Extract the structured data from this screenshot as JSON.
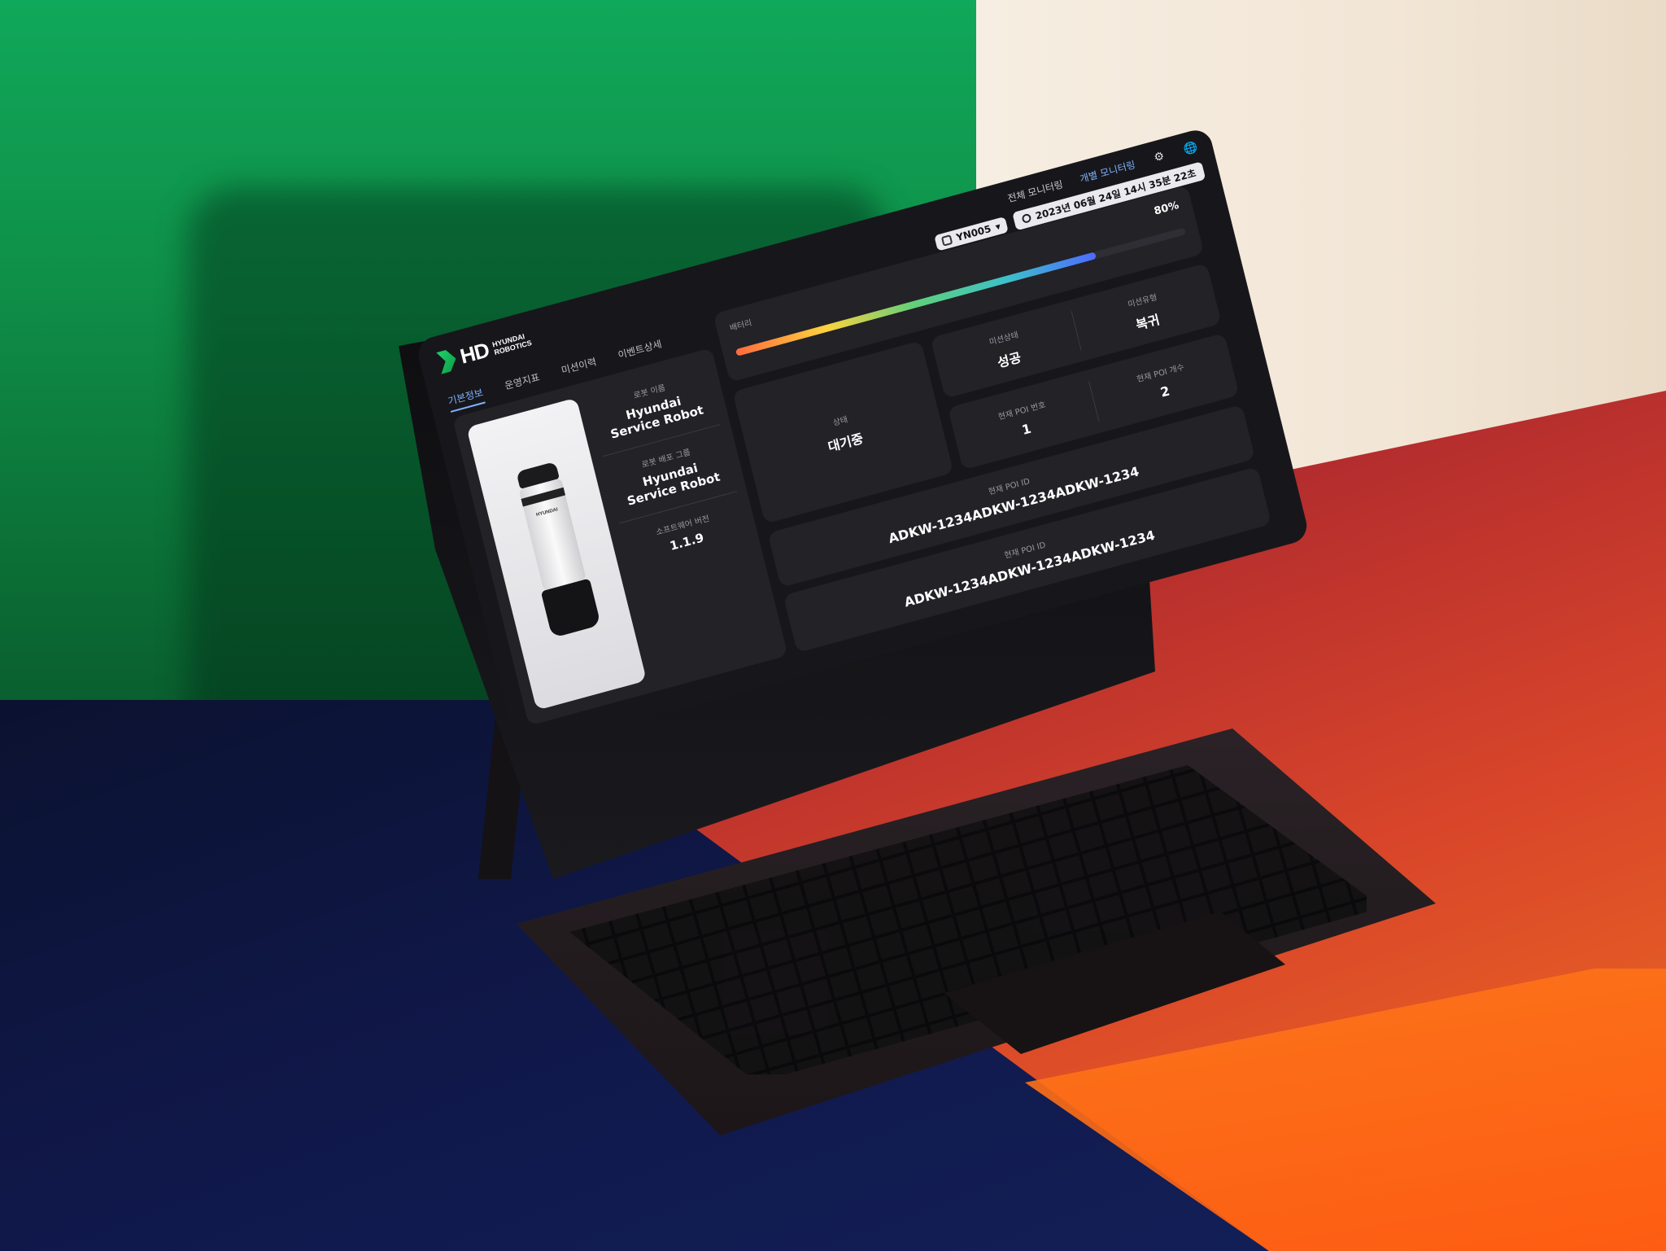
{
  "brand": {
    "logo_main": "HD",
    "logo_line1": "HYUNDAI",
    "logo_line2": "ROBOTICS"
  },
  "top_nav": {
    "overall": "전체 모니터링",
    "individual": "개별 모니터링"
  },
  "icons": {
    "settings": "gear-icon",
    "language": "globe-icon",
    "robot": "robot-icon",
    "clock": "clock-icon",
    "chevron": "chevron-down-icon"
  },
  "robot_select": {
    "value": "YN005"
  },
  "datetime": {
    "value": "2023년 06월 24일 14시 35분 22초"
  },
  "tabs": [
    {
      "label": "기본정보",
      "active": true
    },
    {
      "label": "운영지표",
      "active": false
    },
    {
      "label": "미션이력",
      "active": false
    },
    {
      "label": "이벤트상세",
      "active": false
    }
  ],
  "robot_info": {
    "image_brand": "HYUNDAI",
    "name_label": "로봇 이름",
    "name_value": "Hyundai\nService Robot",
    "group_label": "로봇 배포 그룹",
    "group_value": "Hyundai\nService Robot",
    "sw_label": "소프트웨어 버전",
    "sw_value": "1.1.9"
  },
  "battery": {
    "label": "배터리",
    "percent_text": "80%",
    "level": 0.8
  },
  "status": {
    "label": "상태",
    "value": "대기중"
  },
  "mission": {
    "state_label": "미션상태",
    "state_value": "성공",
    "type_label": "미션유형",
    "type_value": "복귀"
  },
  "poi": {
    "current_no_label": "현재 POI 번호",
    "current_no_value": "1",
    "count_label": "현재 POI 개수",
    "count_value": "2"
  },
  "poi_id_1": {
    "label": "현재 POI ID",
    "value": "ADKW-1234ADKW-1234ADKW-1234"
  },
  "poi_id_2": {
    "label": "현재 POI ID",
    "value": "ADKW-1234ADKW-1234ADKW-1234"
  },
  "colors": {
    "accent": "#7fb2ff",
    "background": "#17171b",
    "card": "#222227",
    "logo_green": "#1cd26a"
  }
}
